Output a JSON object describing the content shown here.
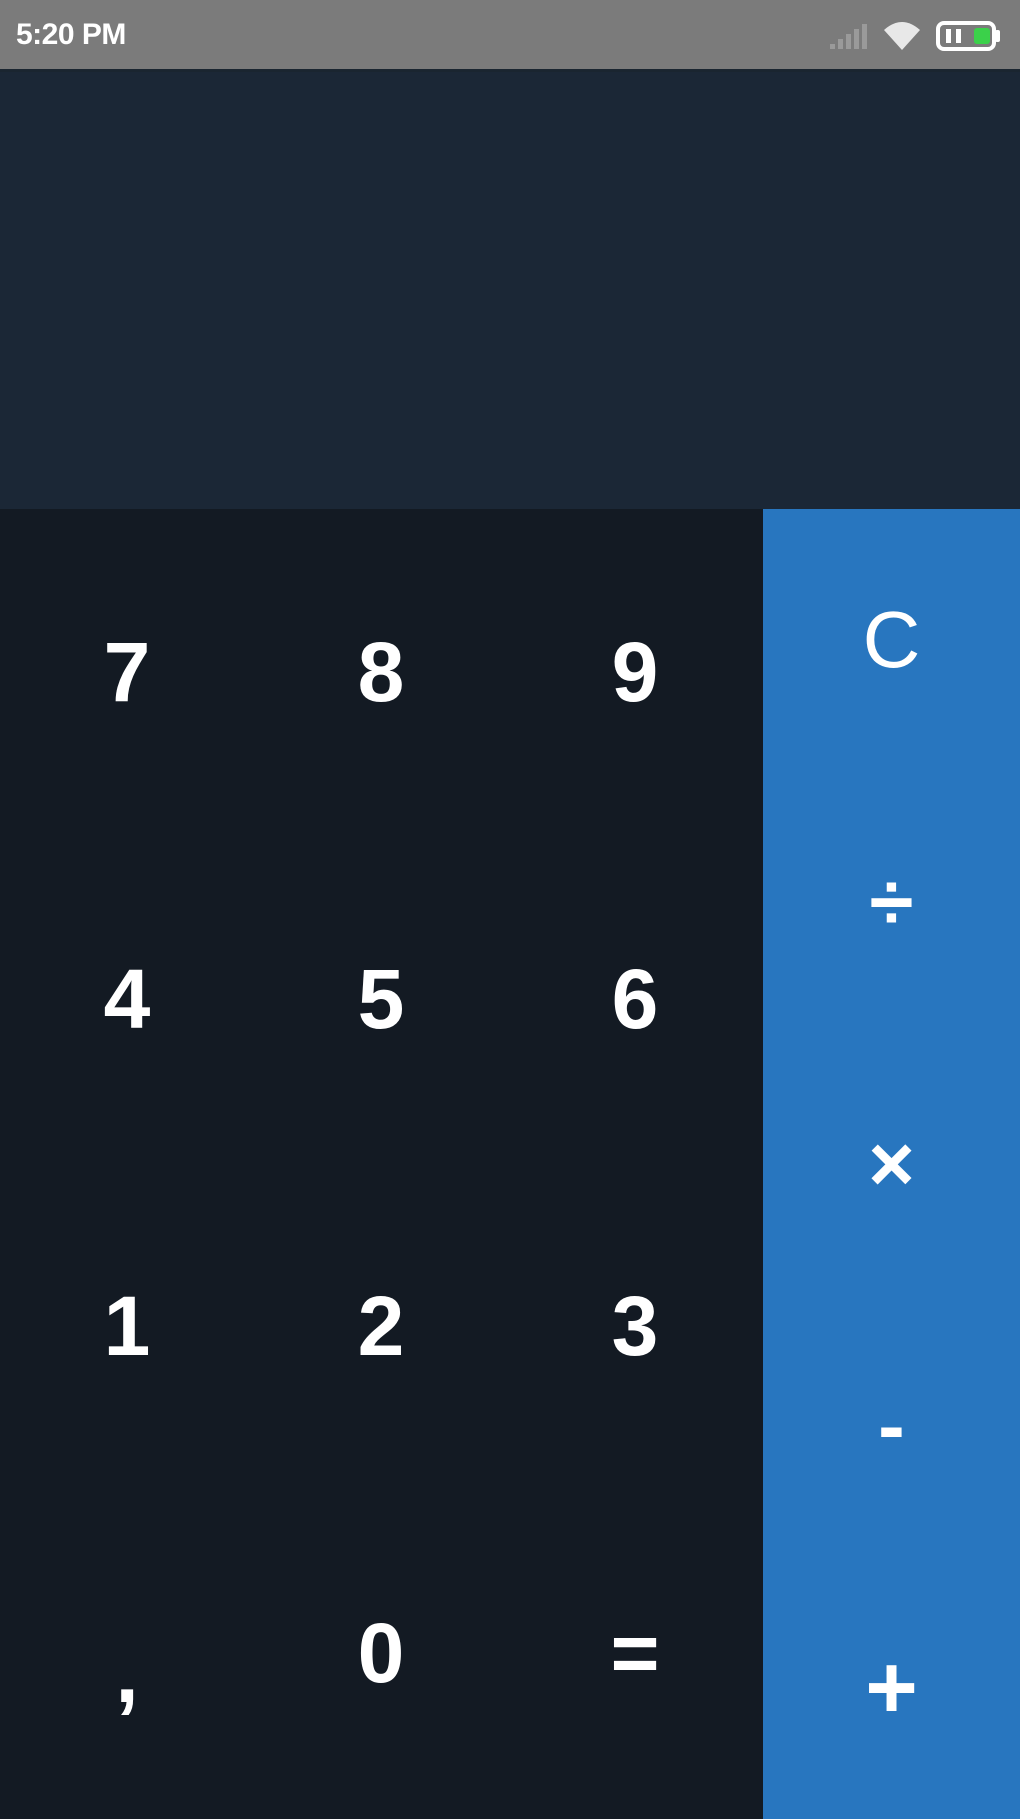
{
  "status_bar": {
    "time": "5:20 PM",
    "icons": [
      "signal-icon",
      "wifi-icon",
      "battery-icon"
    ]
  },
  "display": {
    "value": ""
  },
  "keypad": {
    "rows": [
      [
        "7",
        "8",
        "9"
      ],
      [
        "4",
        "5",
        "6"
      ],
      [
        "1",
        "2",
        "3"
      ],
      [
        ",",
        "0",
        "="
      ]
    ]
  },
  "operators": [
    "C",
    "÷",
    "×",
    "-",
    "+"
  ],
  "colors": {
    "status_bar": "#7b7b7b",
    "display_bg": "#1b2736",
    "keypad_bg": "#131a23",
    "operator_bg": "#2876bf",
    "text": "#ffffff",
    "battery_fill": "#3bd14a"
  }
}
